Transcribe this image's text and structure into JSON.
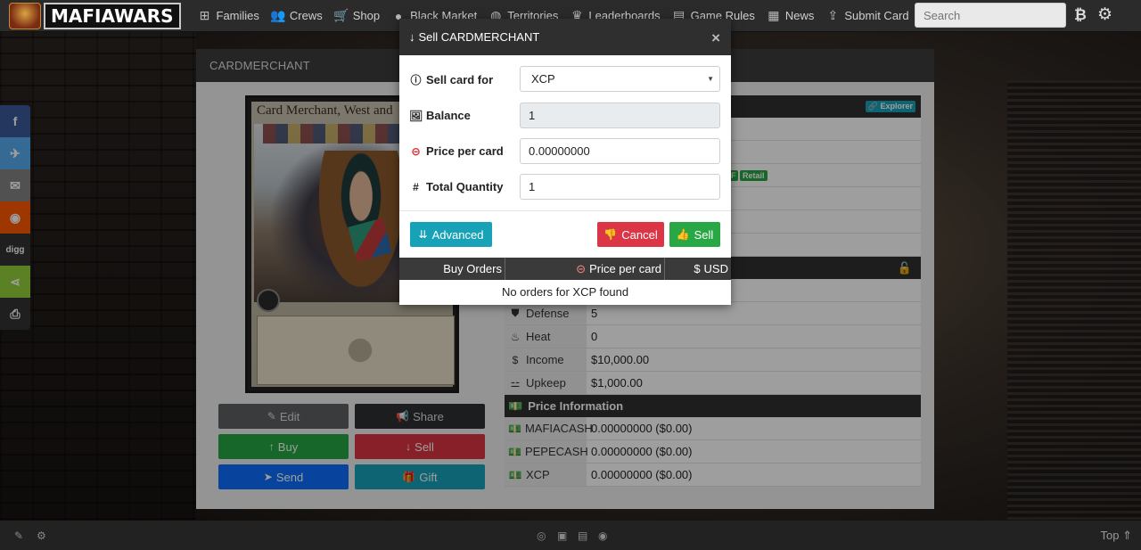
{
  "navbar": {
    "logo_text": "MAFIAWARS",
    "items": [
      {
        "label": "Families",
        "icon": "sitemap-icon",
        "glyph": "⊞"
      },
      {
        "label": "Crews",
        "icon": "users-icon",
        "glyph": "👥"
      },
      {
        "label": "Shop",
        "icon": "cart-icon",
        "glyph": "🛒"
      },
      {
        "label": "Black Market",
        "icon": "bomb-icon",
        "glyph": "●"
      },
      {
        "label": "Territories",
        "icon": "globe-icon",
        "glyph": "◍"
      },
      {
        "label": "Leaderboards",
        "icon": "trophy-icon",
        "glyph": "♛"
      },
      {
        "label": "Game Rules",
        "icon": "book-icon",
        "glyph": "▤"
      },
      {
        "label": "News",
        "icon": "newspaper-icon",
        "glyph": "▦"
      },
      {
        "label": "Submit Card",
        "icon": "upload-icon",
        "glyph": "⇪"
      }
    ],
    "search_placeholder": "Search",
    "btc_glyph": "₿",
    "gear_glyph": "⚙"
  },
  "panel": {
    "title": "CARDMERCHANT",
    "card_title": "Card Merchant, West and",
    "buttons": {
      "edit": "Edit",
      "share": "Share",
      "buy": "Buy",
      "sell": "Sell",
      "send": "Send",
      "gift": "Gift"
    },
    "explorer_badge": "Explorer",
    "retail_badge": "Retail",
    "tf_badge": "F",
    "stats": [
      {
        "icon": "shield-icon",
        "glyph": "⛊",
        "label": "Defense",
        "value": "5"
      },
      {
        "icon": "fire-icon",
        "glyph": "♨",
        "label": "Heat",
        "value": "0"
      },
      {
        "icon": "dollar-icon",
        "glyph": "$",
        "label": "Income",
        "value": "$10,000.00"
      },
      {
        "icon": "hand-coin-icon",
        "glyph": "⚍",
        "label": "Upkeep",
        "value": "$1,000.00"
      }
    ],
    "price_header": "Price Information",
    "prices": [
      {
        "label": "MAFIACASH",
        "value": "0.00000000 ($0.00)"
      },
      {
        "label": "PEPECASH",
        "value": "0.00000000 ($0.00)"
      },
      {
        "label": "XCP",
        "value": "0.00000000 ($0.00)"
      }
    ]
  },
  "social": [
    {
      "name": "facebook-icon",
      "glyph": "f"
    },
    {
      "name": "twitter-icon",
      "glyph": "✈"
    },
    {
      "name": "email-icon",
      "glyph": "✉"
    },
    {
      "name": "reddit-icon",
      "glyph": "◉"
    },
    {
      "name": "digg-icon",
      "glyph": "digg"
    },
    {
      "name": "share-icon",
      "glyph": "⋖"
    },
    {
      "name": "print-icon",
      "glyph": "⎙"
    }
  ],
  "footer": {
    "top_label": "Top ⇑"
  },
  "modal": {
    "title": "Sell CARDMERCHANT",
    "close": "×",
    "fields": {
      "sell_for_label": "Sell card for",
      "sell_for_value": "XCP",
      "balance_label": "Balance",
      "balance_value": "1",
      "price_label": "Price per card",
      "price_value": "0.00000000",
      "quantity_label": "Total Quantity",
      "quantity_value": "1"
    },
    "buttons": {
      "advanced": "Advanced",
      "cancel": "Cancel",
      "sell": "Sell"
    },
    "table": {
      "col1": "Buy Orders",
      "col2": "Price per card",
      "col3": "USD"
    },
    "empty_message": "No orders for XCP found"
  }
}
